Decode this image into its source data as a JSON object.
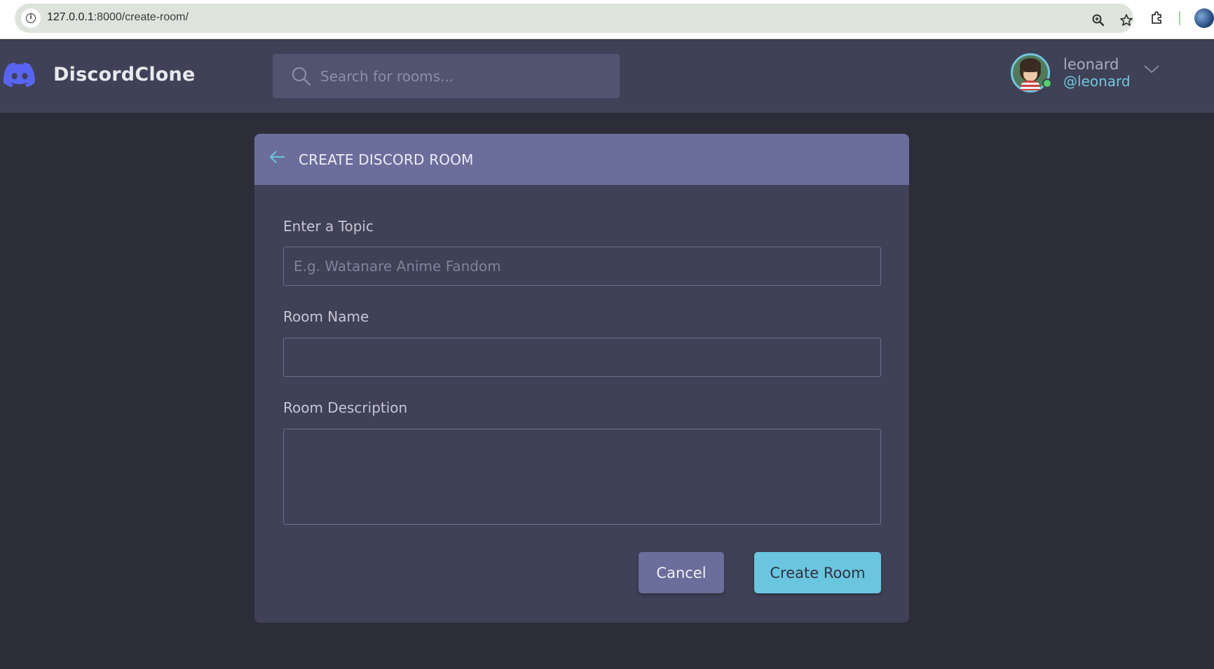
{
  "browser": {
    "url_host": "127.0.0.1",
    "url_rest": ":8000/create-room/"
  },
  "header": {
    "brand": "DiscordClone",
    "search_placeholder": "Search for rooms...",
    "user": {
      "name": "leonard",
      "handle": "@leonard",
      "status": "online"
    }
  },
  "form": {
    "title": "CREATE DISCORD ROOM",
    "topic": {
      "label": "Enter a Topic",
      "placeholder": "E.g. Watanare Anime Fandom",
      "value": ""
    },
    "room_name": {
      "label": "Room Name",
      "value": ""
    },
    "room_description": {
      "label": "Room Description",
      "value": ""
    },
    "cancel_label": "Cancel",
    "submit_label": "Create Room"
  },
  "colors": {
    "page_bg": "#2d2d39",
    "header_bg": "#3f4156",
    "card_header": "#6b6e9b",
    "accent": "#71c6dd",
    "brand_blue": "#5865f2",
    "online": "#4fd168"
  },
  "icons": {
    "logo": "discord-logo-icon",
    "search": "search-icon",
    "back": "arrow-left-icon",
    "menu": "chevron-down-icon"
  }
}
